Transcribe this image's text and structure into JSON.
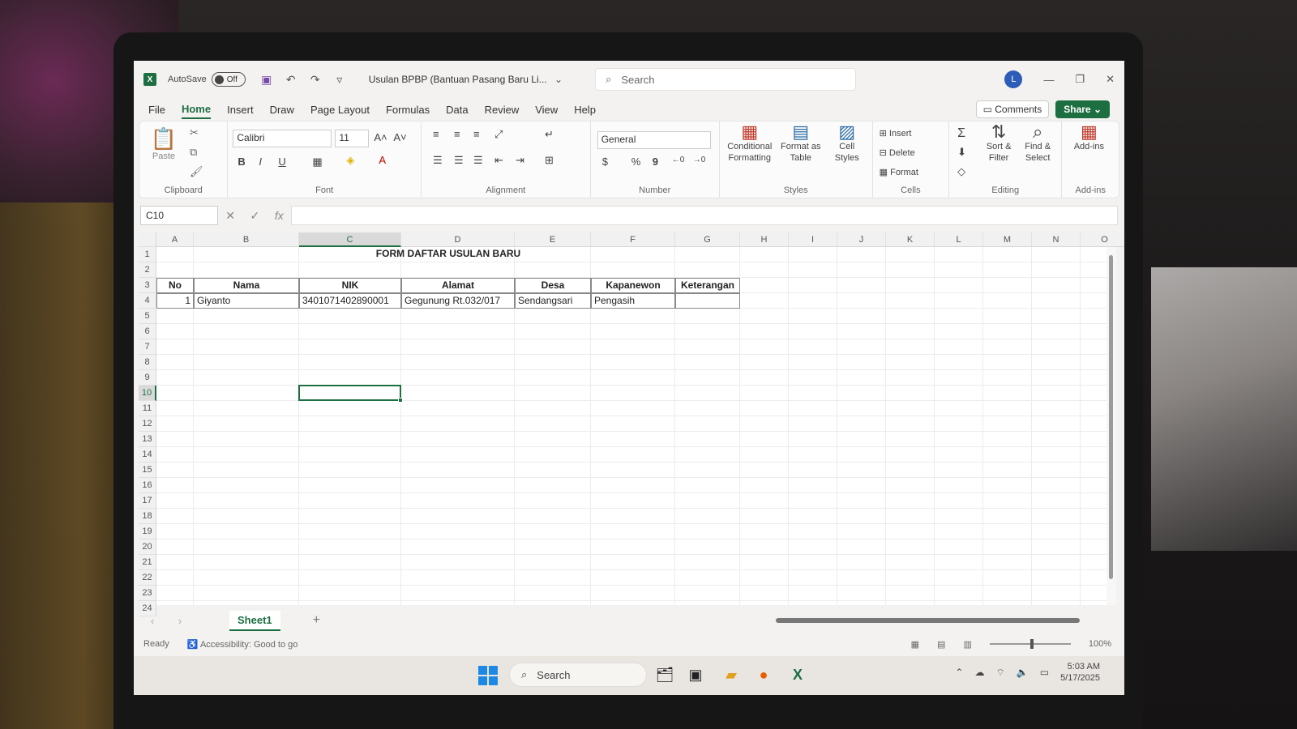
{
  "titlebar": {
    "autosave_label": "AutoSave",
    "autosave_state": "Off",
    "document_title": "Usulan BPBP (Bantuan Pasang Baru Li...",
    "search_placeholder": "Search",
    "avatar_initial": "L"
  },
  "menu": {
    "items": [
      "File",
      "Home",
      "Insert",
      "Draw",
      "Page Layout",
      "Formulas",
      "Data",
      "Review",
      "View",
      "Help"
    ],
    "active": "Home",
    "comments_label": "Comments",
    "share_label": "Share"
  },
  "ribbon": {
    "clipboard": {
      "label": "Clipboard",
      "paste": "Paste"
    },
    "font": {
      "label": "Font",
      "family": "Calibri",
      "size": "11"
    },
    "alignment": {
      "label": "Alignment"
    },
    "number": {
      "label": "Number",
      "format": "General"
    },
    "styles": {
      "label": "Styles",
      "conditional": "Conditional Formatting",
      "format_table": "Format as Table",
      "cell_styles": "Cell Styles"
    },
    "cells": {
      "label": "Cells",
      "insert": "Insert",
      "delete": "Delete",
      "format": "Format"
    },
    "editing": {
      "label": "Editing",
      "sort": "Sort & Filter",
      "find": "Find & Select"
    },
    "addins": {
      "label": "Add-ins",
      "button": "Add-ins"
    }
  },
  "formula_bar": {
    "name_box": "C10",
    "fx": "fx",
    "value": ""
  },
  "columns": [
    "A",
    "B",
    "C",
    "D",
    "E",
    "F",
    "G",
    "H",
    "I",
    "J",
    "K",
    "L",
    "M",
    "N",
    "O"
  ],
  "rows": [
    "1",
    "2",
    "3",
    "4",
    "5",
    "6",
    "7",
    "8",
    "9",
    "10",
    "11",
    "12",
    "13",
    "14",
    "15",
    "16",
    "17",
    "18",
    "19",
    "20",
    "21",
    "22",
    "23",
    "24"
  ],
  "selected_cell": "C10",
  "sheet": {
    "title": "FORM DAFTAR USULAN BARU",
    "headers": [
      "No",
      "Nama",
      "NIK",
      "Alamat",
      "Desa",
      "Kapanewon",
      "Keterangan"
    ],
    "rows": [
      [
        "1",
        "Giyanto",
        "3401071402890001",
        "Gegunung Rt.032/017",
        "Sendangsari",
        "Pengasih",
        ""
      ]
    ]
  },
  "sheet_tabs": {
    "tabs": [
      "Sheet1"
    ],
    "add": "+"
  },
  "status": {
    "ready": "Ready",
    "accessibility": "Accessibility: Good to go",
    "zoom": "100%"
  },
  "taskbar": {
    "search": "Search",
    "time": "5:03 AM",
    "date": "5/17/2025"
  },
  "colors": {
    "excel_green": "#1d6f42",
    "accent_blue": "#1e88e5"
  }
}
